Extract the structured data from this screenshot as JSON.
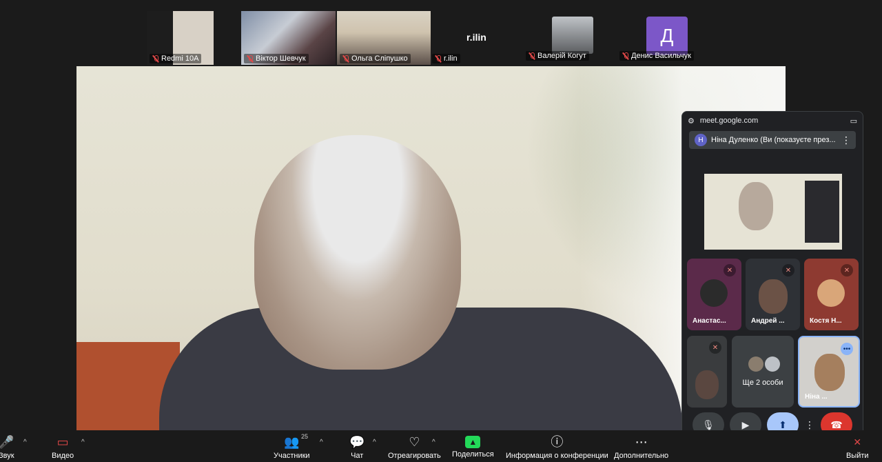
{
  "participants_strip": [
    {
      "name": "Redmi 10A",
      "muted": true
    },
    {
      "name": "Віктор Шевчук",
      "muted": true
    },
    {
      "name": "Ольга Сліпушко",
      "muted": true
    },
    {
      "name": "r.ilin",
      "muted": true,
      "tile_text": "r.ilin"
    },
    {
      "name": "Валерій Когут",
      "muted": true
    },
    {
      "name": "Денис Васильчук",
      "muted": true,
      "avatar_letter": "Д"
    }
  ],
  "pip": {
    "url": "meet.google.com",
    "banner_avatar": "Н",
    "banner_text": "Ніна Дуленко (Ви (показуєте през...",
    "tiles": [
      {
        "name": "Анастас..."
      },
      {
        "name": "Андрей ..."
      },
      {
        "name": "Костя Н..."
      },
      {
        "name": ""
      },
      {
        "name": "Ще 2 особи"
      },
      {
        "name": "Ніна ..."
      }
    ]
  },
  "toolbar": {
    "sound": "Звук",
    "video": "Видео",
    "participants": "Участники",
    "participants_count": "25",
    "chat": "Чат",
    "react": "Отреагировать",
    "share": "Поделиться",
    "info": "Информация о конференции",
    "more": "Дополнительно",
    "leave": "Выйти"
  },
  "colors": {
    "accent_share": "#23d959",
    "muted_red": "#e04848",
    "meet_blue": "#a8c7fa",
    "end_call_red": "#dc362e"
  }
}
